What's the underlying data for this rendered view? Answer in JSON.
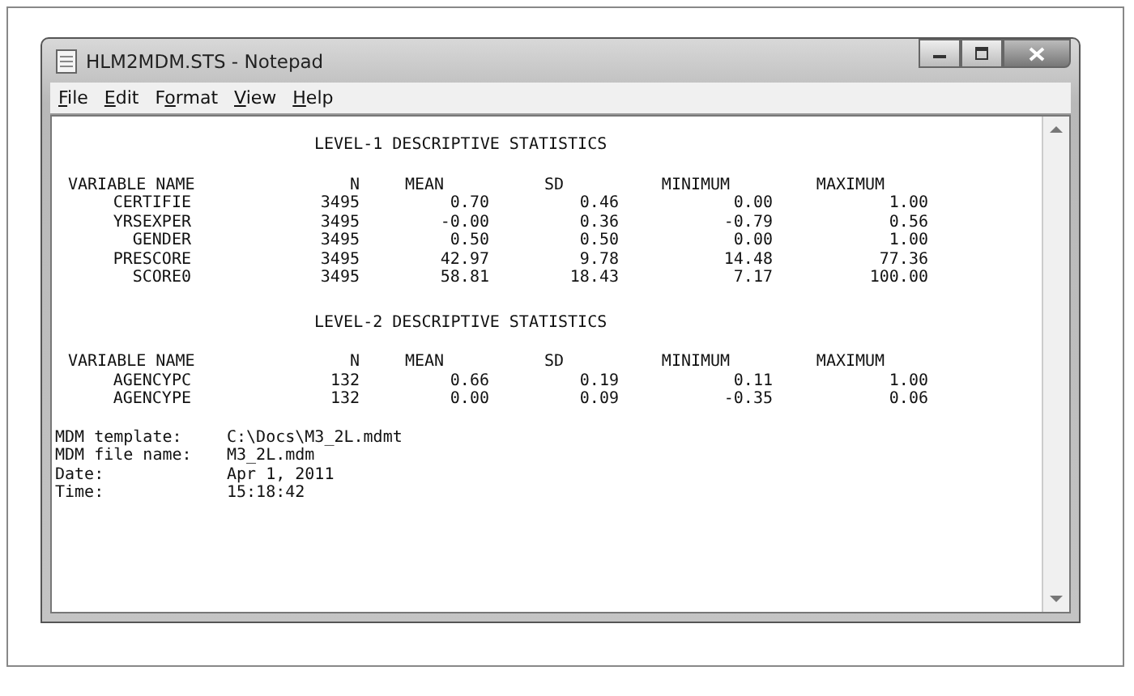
{
  "window": {
    "title": "HLM2MDM.STS - Notepad"
  },
  "menu": [
    {
      "underlined": "F",
      "rest": "ile"
    },
    {
      "underlined": "E",
      "rest": "dit"
    },
    {
      "before": "F",
      "underlined": "o",
      "rest": "rmat"
    },
    {
      "underlined": "V",
      "rest": "iew"
    },
    {
      "underlined": "H",
      "rest": "elp"
    }
  ],
  "sections": [
    {
      "title": "LEVEL-1 DESCRIPTIVE STATISTICS",
      "columns": [
        "VARIABLE NAME",
        "N",
        "MEAN",
        "SD",
        "MINIMUM",
        "MAXIMUM"
      ],
      "rows": [
        [
          "CERTIFIE",
          "3495",
          "0.70",
          "0.46",
          "0.00",
          "1.00"
        ],
        [
          "YRSEXPER",
          "3495",
          "-0.00",
          "0.36",
          "-0.79",
          "0.56"
        ],
        [
          "GENDER",
          "3495",
          "0.50",
          "0.50",
          "0.00",
          "1.00"
        ],
        [
          "PRESCORE",
          "3495",
          "42.97",
          "9.78",
          "14.48",
          "77.36"
        ],
        [
          "SCORE0",
          "3495",
          "58.81",
          "18.43",
          "7.17",
          "100.00"
        ]
      ]
    },
    {
      "title": "LEVEL-2 DESCRIPTIVE STATISTICS",
      "columns": [
        "VARIABLE NAME",
        "N",
        "MEAN",
        "SD",
        "MINIMUM",
        "MAXIMUM"
      ],
      "rows": [
        [
          "AGENCYPC",
          "132",
          "0.66",
          "0.19",
          "0.11",
          "1.00"
        ],
        [
          "AGENCYPE",
          "132",
          "0.00",
          "0.09",
          "-0.35",
          "0.06"
        ]
      ]
    }
  ],
  "info": [
    {
      "label": "MDM template:",
      "value": "C:\\Docs\\M3_2L.mdmt"
    },
    {
      "label": "MDM file name:",
      "value": "M3_2L.mdm"
    },
    {
      "label": "Date:",
      "value": "Apr 1, 2011"
    },
    {
      "label": "Time:",
      "value": "15:18:42"
    }
  ]
}
